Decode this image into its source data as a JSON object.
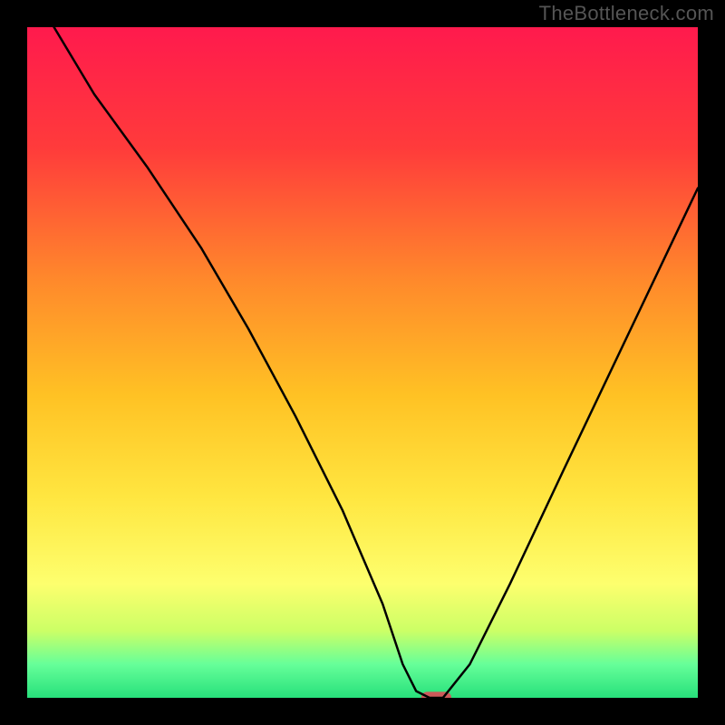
{
  "watermark": "TheBottleneck.com",
  "chart_data": {
    "type": "line",
    "title": "",
    "xlabel": "",
    "ylabel": "",
    "xlim": [
      0,
      100
    ],
    "ylim": [
      0,
      100
    ],
    "grid": false,
    "background_gradient": {
      "stops": [
        {
          "offset": 0.0,
          "color": "#ff1a4d"
        },
        {
          "offset": 0.18,
          "color": "#ff3b3b"
        },
        {
          "offset": 0.38,
          "color": "#ff8a2b"
        },
        {
          "offset": 0.55,
          "color": "#ffc224"
        },
        {
          "offset": 0.7,
          "color": "#ffe640"
        },
        {
          "offset": 0.83,
          "color": "#fdff6e"
        },
        {
          "offset": 0.9,
          "color": "#ccff66"
        },
        {
          "offset": 0.95,
          "color": "#66ff99"
        },
        {
          "offset": 1.0,
          "color": "#27e07b"
        }
      ]
    },
    "baseline_y": 0,
    "series": [
      {
        "name": "bottleneck-curve",
        "color": "#000000",
        "stroke_width": 2.5,
        "x": [
          4,
          10,
          18,
          26,
          33,
          40,
          47,
          53,
          56,
          58,
          60,
          62,
          66,
          72,
          80,
          90,
          100
        ],
        "y": [
          100,
          90,
          79,
          67,
          55,
          42,
          28,
          14,
          5,
          1,
          0,
          0,
          5,
          17,
          34,
          55,
          76
        ]
      }
    ],
    "marker": {
      "name": "minimum-marker",
      "shape": "pill",
      "x": 61,
      "y": 0,
      "width_units": 4.5,
      "height_units": 1.8,
      "fill": "#cc5a5a"
    }
  }
}
